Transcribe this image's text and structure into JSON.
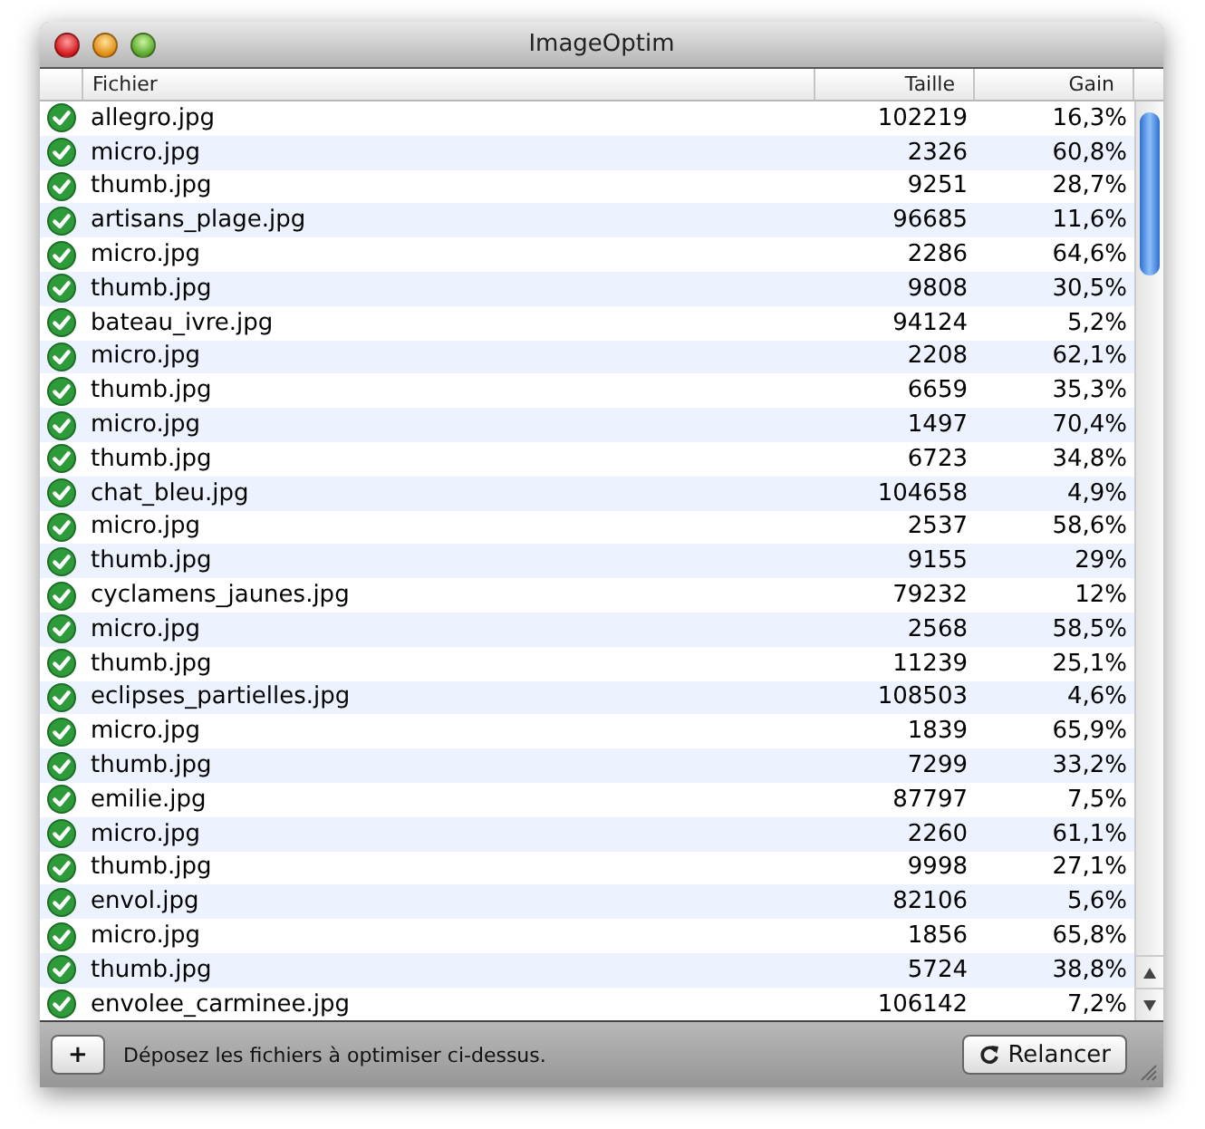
{
  "window": {
    "title": "ImageOptim"
  },
  "table": {
    "columns": [
      "Fichier",
      "Taille",
      "Gain"
    ],
    "rows": [
      {
        "done": true,
        "file": "allegro.jpg",
        "size": "102219",
        "gain": "16,3%"
      },
      {
        "done": true,
        "file": "micro.jpg",
        "size": "2326",
        "gain": "60,8%"
      },
      {
        "done": true,
        "file": "thumb.jpg",
        "size": "9251",
        "gain": "28,7%"
      },
      {
        "done": true,
        "file": "artisans_plage.jpg",
        "size": "96685",
        "gain": "11,6%"
      },
      {
        "done": true,
        "file": "micro.jpg",
        "size": "2286",
        "gain": "64,6%"
      },
      {
        "done": true,
        "file": "thumb.jpg",
        "size": "9808",
        "gain": "30,5%"
      },
      {
        "done": true,
        "file": "bateau_ivre.jpg",
        "size": "94124",
        "gain": "5,2%"
      },
      {
        "done": true,
        "file": "micro.jpg",
        "size": "2208",
        "gain": "62,1%"
      },
      {
        "done": true,
        "file": "thumb.jpg",
        "size": "6659",
        "gain": "35,3%"
      },
      {
        "done": true,
        "file": "micro.jpg",
        "size": "1497",
        "gain": "70,4%"
      },
      {
        "done": true,
        "file": "thumb.jpg",
        "size": "6723",
        "gain": "34,8%"
      },
      {
        "done": true,
        "file": "chat_bleu.jpg",
        "size": "104658",
        "gain": "4,9%"
      },
      {
        "done": true,
        "file": "micro.jpg",
        "size": "2537",
        "gain": "58,6%"
      },
      {
        "done": true,
        "file": "thumb.jpg",
        "size": "9155",
        "gain": "29%"
      },
      {
        "done": true,
        "file": "cyclamens_jaunes.jpg",
        "size": "79232",
        "gain": "12%"
      },
      {
        "done": true,
        "file": "micro.jpg",
        "size": "2568",
        "gain": "58,5%"
      },
      {
        "done": true,
        "file": "thumb.jpg",
        "size": "11239",
        "gain": "25,1%"
      },
      {
        "done": true,
        "file": "eclipses_partielles.jpg",
        "size": "108503",
        "gain": "4,6%"
      },
      {
        "done": true,
        "file": "micro.jpg",
        "size": "1839",
        "gain": "65,9%"
      },
      {
        "done": true,
        "file": "thumb.jpg",
        "size": "7299",
        "gain": "33,2%"
      },
      {
        "done": true,
        "file": "emilie.jpg",
        "size": "87797",
        "gain": "7,5%"
      },
      {
        "done": true,
        "file": "micro.jpg",
        "size": "2260",
        "gain": "61,1%"
      },
      {
        "done": true,
        "file": "thumb.jpg",
        "size": "9998",
        "gain": "27,1%"
      },
      {
        "done": true,
        "file": "envol.jpg",
        "size": "82106",
        "gain": "5,6%"
      },
      {
        "done": true,
        "file": "micro.jpg",
        "size": "1856",
        "gain": "65,8%"
      },
      {
        "done": true,
        "file": "thumb.jpg",
        "size": "5724",
        "gain": "38,8%"
      },
      {
        "done": true,
        "file": "envolee_carminee.jpg",
        "size": "106142",
        "gain": "7,2%"
      }
    ]
  },
  "bottom_bar": {
    "add_button": "+",
    "hint": "Déposez les fichiers à optimiser ci-dessus.",
    "rerun_button": "Relancer"
  }
}
